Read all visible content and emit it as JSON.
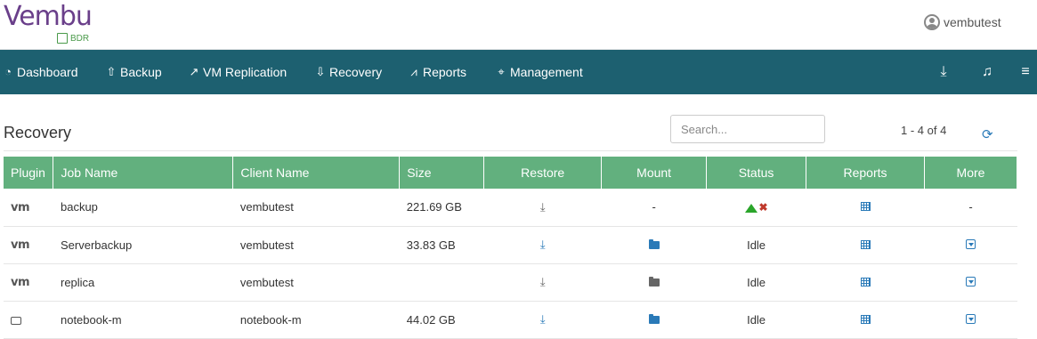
{
  "header": {
    "logo_text": "Vembu",
    "logo_sub": "BDR",
    "username": "vembutest"
  },
  "nav": {
    "items": [
      {
        "label": "Dashboard",
        "icon": "dashboard-icon"
      },
      {
        "label": "Backup",
        "icon": "upload-icon"
      },
      {
        "label": "VM Replication",
        "icon": "external-link-icon"
      },
      {
        "label": "Recovery",
        "icon": "download-icon"
      },
      {
        "label": "Reports",
        "icon": "line-chart-icon"
      },
      {
        "label": "Management",
        "icon": "crosshairs-icon"
      }
    ],
    "right_icons": [
      "download-icon",
      "bell-icon",
      "menu-icon"
    ],
    "bg_color": "#1d6070"
  },
  "page": {
    "title": "Recovery",
    "search_placeholder": "Search...",
    "pagination": "1 - 4 of 4"
  },
  "table": {
    "header_color": "#62b07e",
    "columns": [
      "Plugin",
      "Job Name",
      "Client Name",
      "Size",
      "Restore",
      "Mount",
      "Status",
      "Reports",
      "More"
    ],
    "rows": [
      {
        "plugin": "vm",
        "job": "backup",
        "client": "vembutest",
        "size": "221.69 GB",
        "restore": "download-icon-grey",
        "mount": "-",
        "status": "icons",
        "reports": "calendar-icon",
        "more": "-"
      },
      {
        "plugin": "vm",
        "job": "Serverbackup",
        "client": "vembutest",
        "size": "33.83 GB",
        "restore": "download-icon-blue",
        "mount": "folder-open-icon-blue",
        "status": "Idle",
        "reports": "calendar-icon",
        "more": "dropdown-icon"
      },
      {
        "plugin": "vm",
        "job": "replica",
        "client": "vembutest",
        "size": "",
        "restore": "download-icon-grey",
        "mount": "folder-icon-grey",
        "status": "Idle",
        "reports": "calendar-icon",
        "more": "dropdown-icon"
      },
      {
        "plugin": "disk",
        "job": "notebook-m",
        "client": "notebook-m",
        "size": "44.02 GB",
        "restore": "download-icon-blue",
        "mount": "folder-icon-blue",
        "status": "Idle",
        "reports": "calendar-icon",
        "more": "dropdown-icon"
      }
    ]
  }
}
